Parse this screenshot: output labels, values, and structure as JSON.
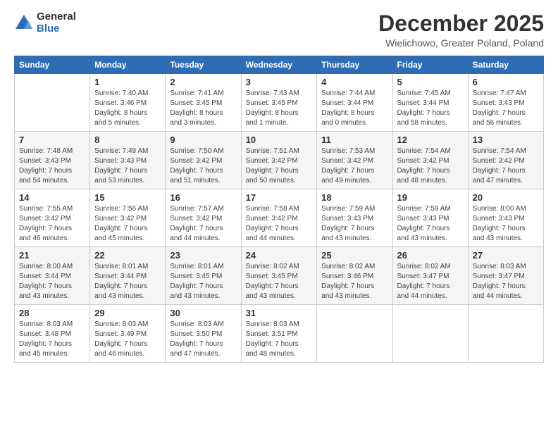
{
  "logo": {
    "general": "General",
    "blue": "Blue"
  },
  "title": "December 2025",
  "location": "Wielichowo, Greater Poland, Poland",
  "days_of_week": [
    "Sunday",
    "Monday",
    "Tuesday",
    "Wednesday",
    "Thursday",
    "Friday",
    "Saturday"
  ],
  "weeks": [
    [
      {
        "day": "",
        "info": ""
      },
      {
        "day": "1",
        "info": "Sunrise: 7:40 AM\nSunset: 3:46 PM\nDaylight: 8 hours\nand 5 minutes."
      },
      {
        "day": "2",
        "info": "Sunrise: 7:41 AM\nSunset: 3:45 PM\nDaylight: 8 hours\nand 3 minutes."
      },
      {
        "day": "3",
        "info": "Sunrise: 7:43 AM\nSunset: 3:45 PM\nDaylight: 8 hours\nand 1 minute."
      },
      {
        "day": "4",
        "info": "Sunrise: 7:44 AM\nSunset: 3:44 PM\nDaylight: 8 hours\nand 0 minutes."
      },
      {
        "day": "5",
        "info": "Sunrise: 7:45 AM\nSunset: 3:44 PM\nDaylight: 7 hours\nand 58 minutes."
      },
      {
        "day": "6",
        "info": "Sunrise: 7:47 AM\nSunset: 3:43 PM\nDaylight: 7 hours\nand 56 minutes."
      }
    ],
    [
      {
        "day": "7",
        "info": "Sunrise: 7:48 AM\nSunset: 3:43 PM\nDaylight: 7 hours\nand 54 minutes."
      },
      {
        "day": "8",
        "info": "Sunrise: 7:49 AM\nSunset: 3:43 PM\nDaylight: 7 hours\nand 53 minutes."
      },
      {
        "day": "9",
        "info": "Sunrise: 7:50 AM\nSunset: 3:42 PM\nDaylight: 7 hours\nand 51 minutes."
      },
      {
        "day": "10",
        "info": "Sunrise: 7:51 AM\nSunset: 3:42 PM\nDaylight: 7 hours\nand 50 minutes."
      },
      {
        "day": "11",
        "info": "Sunrise: 7:53 AM\nSunset: 3:42 PM\nDaylight: 7 hours\nand 49 minutes."
      },
      {
        "day": "12",
        "info": "Sunrise: 7:54 AM\nSunset: 3:42 PM\nDaylight: 7 hours\nand 48 minutes."
      },
      {
        "day": "13",
        "info": "Sunrise: 7:54 AM\nSunset: 3:42 PM\nDaylight: 7 hours\nand 47 minutes."
      }
    ],
    [
      {
        "day": "14",
        "info": "Sunrise: 7:55 AM\nSunset: 3:42 PM\nDaylight: 7 hours\nand 46 minutes."
      },
      {
        "day": "15",
        "info": "Sunrise: 7:56 AM\nSunset: 3:42 PM\nDaylight: 7 hours\nand 45 minutes."
      },
      {
        "day": "16",
        "info": "Sunrise: 7:57 AM\nSunset: 3:42 PM\nDaylight: 7 hours\nand 44 minutes."
      },
      {
        "day": "17",
        "info": "Sunrise: 7:58 AM\nSunset: 3:42 PM\nDaylight: 7 hours\nand 44 minutes."
      },
      {
        "day": "18",
        "info": "Sunrise: 7:59 AM\nSunset: 3:43 PM\nDaylight: 7 hours\nand 43 minutes."
      },
      {
        "day": "19",
        "info": "Sunrise: 7:59 AM\nSunset: 3:43 PM\nDaylight: 7 hours\nand 43 minutes."
      },
      {
        "day": "20",
        "info": "Sunrise: 8:00 AM\nSunset: 3:43 PM\nDaylight: 7 hours\nand 43 minutes."
      }
    ],
    [
      {
        "day": "21",
        "info": "Sunrise: 8:00 AM\nSunset: 3:44 PM\nDaylight: 7 hours\nand 43 minutes."
      },
      {
        "day": "22",
        "info": "Sunrise: 8:01 AM\nSunset: 3:44 PM\nDaylight: 7 hours\nand 43 minutes."
      },
      {
        "day": "23",
        "info": "Sunrise: 8:01 AM\nSunset: 3:45 PM\nDaylight: 7 hours\nand 43 minutes."
      },
      {
        "day": "24",
        "info": "Sunrise: 8:02 AM\nSunset: 3:45 PM\nDaylight: 7 hours\nand 43 minutes."
      },
      {
        "day": "25",
        "info": "Sunrise: 8:02 AM\nSunset: 3:46 PM\nDaylight: 7 hours\nand 43 minutes."
      },
      {
        "day": "26",
        "info": "Sunrise: 8:02 AM\nSunset: 3:47 PM\nDaylight: 7 hours\nand 44 minutes."
      },
      {
        "day": "27",
        "info": "Sunrise: 8:03 AM\nSunset: 3:47 PM\nDaylight: 7 hours\nand 44 minutes."
      }
    ],
    [
      {
        "day": "28",
        "info": "Sunrise: 8:03 AM\nSunset: 3:48 PM\nDaylight: 7 hours\nand 45 minutes."
      },
      {
        "day": "29",
        "info": "Sunrise: 8:03 AM\nSunset: 3:49 PM\nDaylight: 7 hours\nand 46 minutes."
      },
      {
        "day": "30",
        "info": "Sunrise: 8:03 AM\nSunset: 3:50 PM\nDaylight: 7 hours\nand 47 minutes."
      },
      {
        "day": "31",
        "info": "Sunrise: 8:03 AM\nSunset: 3:51 PM\nDaylight: 7 hours\nand 48 minutes."
      },
      {
        "day": "",
        "info": ""
      },
      {
        "day": "",
        "info": ""
      },
      {
        "day": "",
        "info": ""
      }
    ]
  ]
}
